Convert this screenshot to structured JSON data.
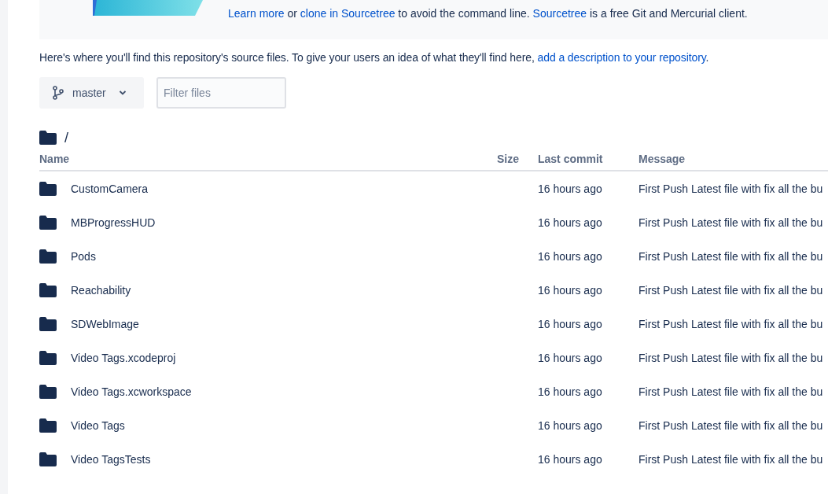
{
  "banner": {
    "parts": [
      {
        "text": "Learn more",
        "link": true
      },
      {
        "text": " or ",
        "link": false
      },
      {
        "text": "clone in Sourcetree",
        "link": true
      },
      {
        "text": " to avoid the command line. ",
        "link": false
      },
      {
        "text": "Sourcetree",
        "link": true
      },
      {
        "text": " is a free Git and Mercurial client.",
        "link": false
      }
    ]
  },
  "intro": {
    "parts": [
      {
        "text": "Here's where you'll find this repository's source files. To give your users an idea of what they'll find here, ",
        "link": false
      },
      {
        "text": "add a description to your repository",
        "link": true
      },
      {
        "text": ".",
        "link": false
      }
    ]
  },
  "branch": {
    "label": "master"
  },
  "filter": {
    "placeholder": "Filter files"
  },
  "path": "/",
  "table": {
    "columns": [
      "Name",
      "Size",
      "Last commit",
      "Message"
    ],
    "rows": [
      {
        "kind": "folder",
        "name": "CustomCamera",
        "last_commit": "16 hours ago",
        "message": "First Push Latest file with fix all the bu"
      },
      {
        "kind": "folder",
        "name": "MBProgressHUD",
        "last_commit": "16 hours ago",
        "message": "First Push Latest file with fix all the bu"
      },
      {
        "kind": "folder",
        "name": "Pods",
        "last_commit": "16 hours ago",
        "message": "First Push Latest file with fix all the bu"
      },
      {
        "kind": "folder",
        "name": "Reachability",
        "last_commit": "16 hours ago",
        "message": "First Push Latest file with fix all the bu"
      },
      {
        "kind": "folder",
        "name": "SDWebImage",
        "last_commit": "16 hours ago",
        "message": "First Push Latest file with fix all the bu"
      },
      {
        "kind": "folder",
        "name": "Video Tags.xcodeproj",
        "last_commit": "16 hours ago",
        "message": "First Push Latest file with fix all the bu"
      },
      {
        "kind": "folder",
        "name": "Video Tags.xcworkspace",
        "last_commit": "16 hours ago",
        "message": "First Push Latest file with fix all the bu"
      },
      {
        "kind": "folder",
        "name": "Video Tags",
        "last_commit": "16 hours ago",
        "message": "First Push Latest file with fix all the bu"
      },
      {
        "kind": "folder",
        "name": "Video TagsTests",
        "last_commit": "16 hours ago",
        "message": "First Push Latest file with fix all the bu"
      }
    ]
  }
}
